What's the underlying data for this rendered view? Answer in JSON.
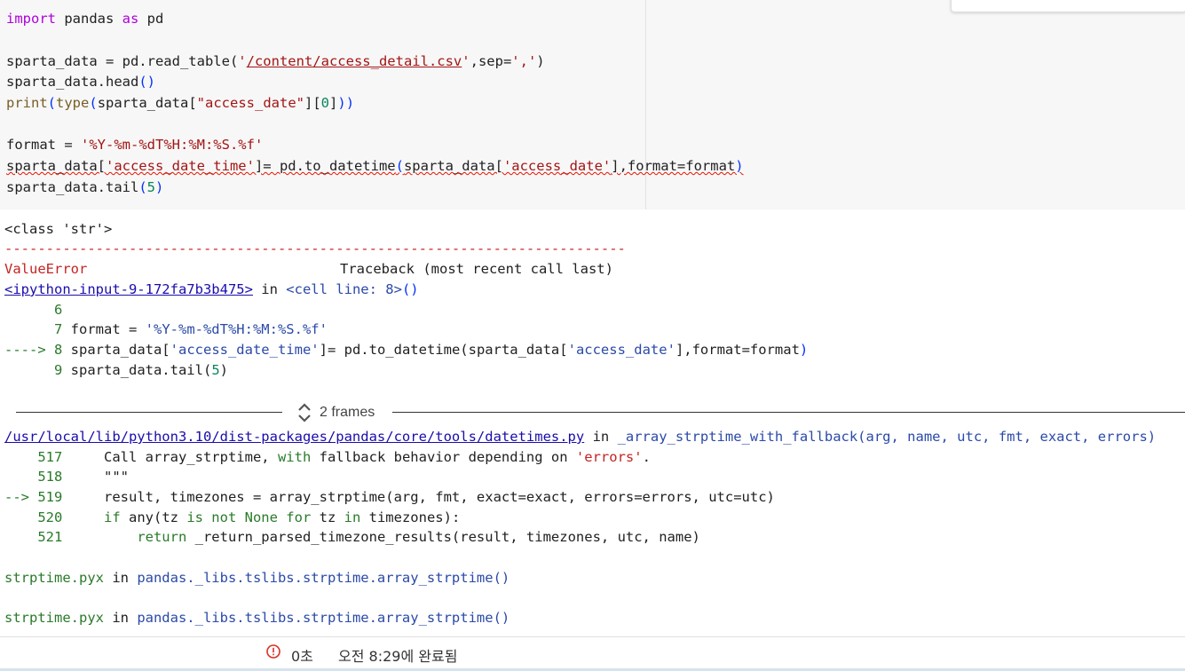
{
  "code": {
    "l1": {
      "kw1": "import",
      "mid": " pandas ",
      "kw2": "as",
      "end": " pd"
    },
    "l2": {
      "a": "sparta_data = pd.read_table(",
      "s1q1": "'",
      "path": "/content/access_detail.csv",
      "s1q2": "'",
      "b": ",sep=",
      "sep": "','",
      "c": ")"
    },
    "l3": {
      "a": "sparta_data.head",
      "p": "()"
    },
    "l4": {
      "fn": "print",
      "p1": "(",
      "fn2": "type",
      "p2": "(",
      "a": "sparta_data[",
      "s": "\"access_date\"",
      "b": "][",
      "n": "0",
      "c": "]",
      "p3": "))"
    },
    "l5": {
      "a": "format = ",
      "s": "'%Y-%m-%dT%H:%M:%S.%f'"
    },
    "l6": {
      "a": "sparta_data[",
      "s1": "'access_date_time'",
      "b": "]= pd.to_datetime",
      "p1": "(",
      "c": "sparta_data[",
      "s2": "'access_date'",
      "d": "],format=format",
      "p2": ")"
    },
    "l7": {
      "a": "sparta_data.tail",
      "p1": "(",
      "n": "5",
      "p2": ")"
    }
  },
  "output": {
    "class_line": "<class 'str'>",
    "dashes": "---------------------------------------------------------------------------",
    "error_name": "ValueError",
    "traceback_header": "Traceback (most recent call last)",
    "input_link": "<ipython-input-9-172fa7b3b475>",
    "in_word": " in ",
    "cell_line": "<cell line: 8>",
    "cell_parens": "()",
    "tb1": {
      "n6": "      6",
      "n7": "      7",
      "l7a": " format = ",
      "l7s": "'%Y-%m-%dT%H:%M:%S.%f'",
      "arrow8": "----> 8",
      "l8a": " sparta_data[",
      "l8s1": "'access_date_time'",
      "l8b": "]= pd.to_datetime(sparta_data[",
      "l8s2": "'access_date'",
      "l8c": "],format=format",
      "l8p": ")",
      "n9": "      9",
      "l9a": " sparta_data.tail(",
      "l9n": "5",
      "l9p": ")"
    },
    "frames_label": "2 frames",
    "file_link": "/usr/local/lib/python3.10/dist-packages/pandas/core/tools/datetimes.py",
    "func_sig": "_array_strptime_with_fallback(arg, name, utc, fmt, exact, errors)",
    "tb2": {
      "n517": "    517",
      "l517a": "     Call array_strptime, ",
      "l517kw": "with",
      "l517b": " fallback behavior depending on ",
      "l517s": "'errors'",
      "l517c": ".",
      "n518": "    518",
      "l518": "     \"\"\"",
      "arrow519": "--> 519",
      "l519": "     result, timezones = array_strptime(arg, fmt, exact=exact, errors=errors, utc=utc)",
      "n520": "    520",
      "l520kw1": "     if",
      "l520a": " any(tz ",
      "l520kw2": "is not None for",
      "l520b": " tz ",
      "l520kw3": "in",
      "l520c": " timezones):",
      "n521": "    521",
      "l521kw": "         return",
      "l521": " _return_parsed_timezone_results(result, timezones, utc, name)"
    },
    "pyx1_file": "strptime.pyx",
    "pyx1_func": "pandas._libs.tslibs.strptime.array_strptime()",
    "pyx2_file": "strptime.pyx",
    "pyx2_func": "pandas._libs.tslibs.strptime.array_strptime()"
  },
  "status": {
    "icon": "error-circle-icon",
    "duration": "0초",
    "completed": "오전 8:29에 완료됨"
  },
  "colors": {
    "error": "#c52323",
    "keyword": "#af00db",
    "string": "#a31515",
    "link": "#1a0dab"
  }
}
